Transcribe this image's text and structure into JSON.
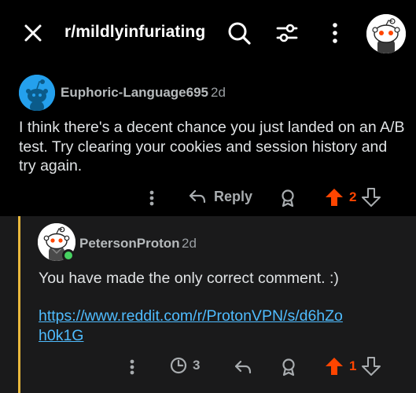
{
  "header": {
    "subreddit": "r/mildlyinfuriating"
  },
  "comments": [
    {
      "author": "Euphoric-Language695",
      "age": "2d",
      "body": "I think there's a decent chance you just landed on an A/B test. Try clearing your cookies and session history and try again.",
      "reply_label": "Reply",
      "score": "2"
    },
    {
      "author": "PetersonProton",
      "age": "2d",
      "body": "You have made the only correct comment. :)",
      "link": "https://www.reddit.com/r/ProtonVPN/s/d6hZoh0k1G",
      "reply_count": "3",
      "score": "1"
    }
  ],
  "colors": {
    "upvote": "#ff4500",
    "link": "#4fbcff",
    "thread_line": "#e8b83c",
    "online": "#46d160",
    "avatar1_bg": "#24a0ed"
  },
  "icons": [
    "close-icon",
    "search-icon",
    "filter-icon",
    "more-vertical-icon",
    "snoo-avatar",
    "reply-arrow-icon",
    "award-icon",
    "upvote-arrow-icon",
    "downvote-arrow-icon",
    "collapse-icon"
  ]
}
